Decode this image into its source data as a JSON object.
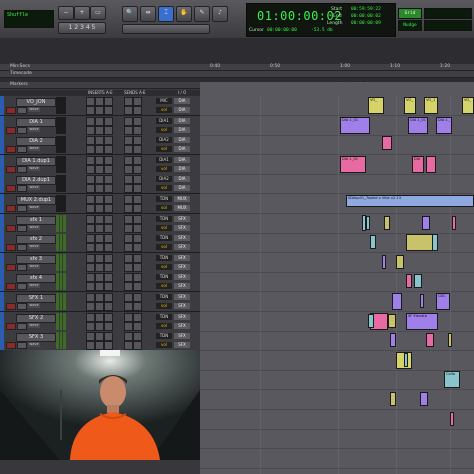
{
  "app": {
    "name": "Pro Tools"
  },
  "toolbar": {
    "mode_label": "Shuffle",
    "nudge_label": "Nudge",
    "grid_label": "Grid",
    "main_counter": "01:00:00:02",
    "start_label": "Start",
    "end_label": "End",
    "length_label": "Length",
    "cursor_label": "Cursor",
    "start_value": "00:59:59:22",
    "end_value": "00:00:00:02",
    "length_value": "00:00:00:09",
    "cursor_value": "00:00:00:00",
    "db_value": "-53.5 db"
  },
  "rulers": {
    "mins_secs": "Min:Secs",
    "timecode": "Timecode",
    "markers": "Markers",
    "location_marker": "Location 1",
    "ticks": [
      "0:40",
      "0:50",
      "1:00",
      "1:10",
      "1:20"
    ]
  },
  "columns": {
    "inserts": "INSERTS A-E",
    "sends": "SENDS A-E",
    "io": "I / O"
  },
  "tracks": [
    {
      "name": "VO_JON",
      "mode": "wave",
      "vol": "MIC",
      "vol2": "vol",
      "io": "DIA",
      "io2": "DIA"
    },
    {
      "name": "DIA 1",
      "mode": "wave",
      "vol": "DIA1",
      "vol2": "vol",
      "io": "DIA",
      "io2": "DIA"
    },
    {
      "name": "DIA 2",
      "mode": "wave",
      "vol": "DIA2",
      "vol2": "vol",
      "io": "DIA",
      "io2": "DIA"
    },
    {
      "name": "DIA 1.dup1",
      "mode": "wave",
      "vol": "DIA1",
      "vol2": "vol",
      "io": "DIA",
      "io2": "DIA"
    },
    {
      "name": "DIA 2.dup1",
      "mode": "wave",
      "vol": "DIA2",
      "vol2": "vol",
      "io": "DIA",
      "io2": "DIA"
    },
    {
      "name": "MUX 2.dup1",
      "mode": "wave",
      "vol": "TDN",
      "vol2": "vol",
      "io": "MUX",
      "io2": "MUX"
    },
    {
      "name": "sfx 1",
      "mode": "wave",
      "vol": "TDN",
      "vol2": "vol",
      "io": "SFX",
      "io2": "SFX"
    },
    {
      "name": "sfx 2",
      "mode": "wave",
      "vol": "TDN",
      "vol2": "vol",
      "io": "SFX",
      "io2": "SFX"
    },
    {
      "name": "sfx 3",
      "mode": "wave",
      "vol": "TDN",
      "vol2": "vol",
      "io": "SFX",
      "io2": "SFX"
    },
    {
      "name": "sfx 4",
      "mode": "wave",
      "vol": "TDN",
      "vol2": "vol",
      "io": "SFX",
      "io2": "SFX"
    },
    {
      "name": "SFX 1",
      "mode": "wave",
      "vol": "TDN",
      "vol2": "vol",
      "io": "SFX",
      "io2": "SFX"
    },
    {
      "name": "SFX 2",
      "mode": "wave",
      "vol": "TDN",
      "vol2": "vol",
      "io": "SFX",
      "io2": "SFX"
    },
    {
      "name": "SFX 3",
      "mode": "wave",
      "vol": "TDN",
      "vol2": "vol",
      "io": "SFX",
      "io2": "SFX"
    }
  ],
  "clips": [
    {
      "lane": 0,
      "label": "VO_",
      "color": "#d6d36a"
    },
    {
      "lane": 0,
      "label": "VO_",
      "color": "#d6d36a"
    },
    {
      "lane": 0,
      "label": "VO_1",
      "color": "#d6d36a"
    },
    {
      "lane": 0,
      "label": "VO_",
      "color": "#d6d36a"
    },
    {
      "lane": 1,
      "label": "DIA 1_01",
      "color": "#9f7fe8"
    },
    {
      "lane": 1,
      "label": "DIA 1_01",
      "color": "#9f7fe8"
    },
    {
      "lane": 1,
      "label": "DIA 1_",
      "color": "#9f7fe8"
    },
    {
      "lane": 2,
      "label": "",
      "color": "#e86aa2"
    },
    {
      "lane": 3,
      "label": "DIA 1_01",
      "color": "#e86aa2"
    },
    {
      "lane": 3,
      "label": "DIA",
      "color": "#e86aa2"
    },
    {
      "lane": 3,
      "label": "",
      "color": "#e86aa2"
    },
    {
      "lane": 5,
      "label": "SDAvp01_Tooled x Vibe v2.13",
      "color": "#8fa8e0"
    },
    {
      "lane": 6,
      "label": "",
      "color": "#88c4cc"
    },
    {
      "lane": 7,
      "label": "",
      "color": "#c8c36a"
    },
    {
      "lane": 7,
      "label": "",
      "color": "#88c4cc"
    },
    {
      "lane": 10,
      "label": "",
      "color": "#9f7fe8"
    },
    {
      "lane": 10,
      "label": "CDC",
      "color": "#9f7fe8"
    },
    {
      "lane": 11,
      "label": "SF Elevato",
      "color": "#9f7fe8"
    },
    {
      "lane": 11,
      "label": "",
      "color": "#e86aa2"
    },
    {
      "lane": 13,
      "label": "",
      "color": "#d6d36a"
    },
    {
      "lane": 14,
      "label": "Colla",
      "color": "#88c4cc"
    }
  ]
}
